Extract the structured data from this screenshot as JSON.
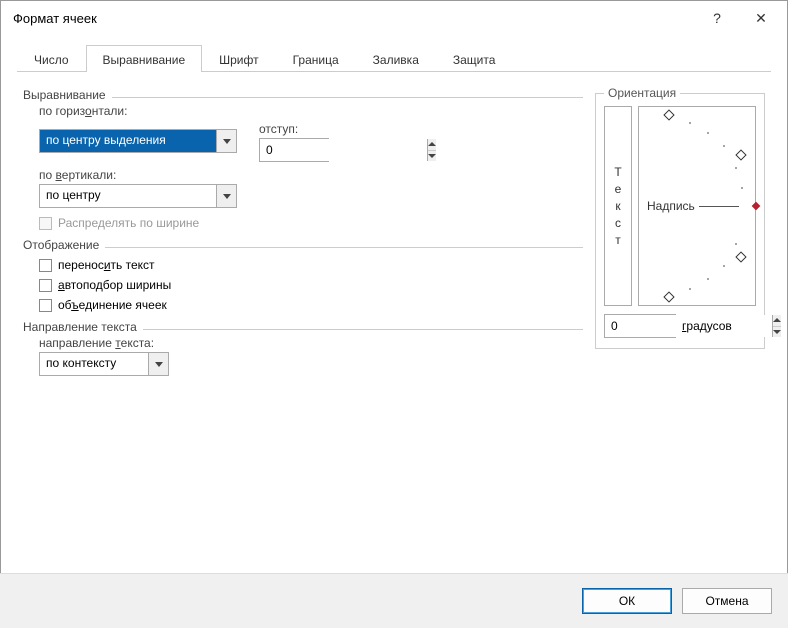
{
  "window": {
    "title": "Формат ячеек",
    "help_icon": "?",
    "close_icon": "✕"
  },
  "tabs": {
    "number": "Число",
    "alignment": "Выравнивание",
    "font": "Шрифт",
    "border": "Граница",
    "fill": "Заливка",
    "protection": "Защита"
  },
  "groups": {
    "alignment": "Выравнивание",
    "display": "Отображение",
    "text_direction": "Направление текста",
    "orientation": "Ориентация"
  },
  "alignment": {
    "horiz_label": "по горизонтали:",
    "horiz_value": "по центру выделения",
    "vert_label": "по вертикали:",
    "vert_value": "по центру",
    "indent_label": "отступ:",
    "indent_value": "0",
    "justify_distributed": "Распределять по ширине"
  },
  "display": {
    "wrap_text": "переносить текст",
    "shrink_to_fit": "автоподбор ширины",
    "merge_cells": "объединение ячеек"
  },
  "text_direction": {
    "label": "направление текста:",
    "value": "по контексту"
  },
  "orientation": {
    "vertical_text": "Т е к с т",
    "dial_label": "Надпись",
    "degrees_value": "0",
    "degrees_label": "градусов"
  },
  "buttons": {
    "ok": "ОК",
    "cancel": "Отмена"
  }
}
